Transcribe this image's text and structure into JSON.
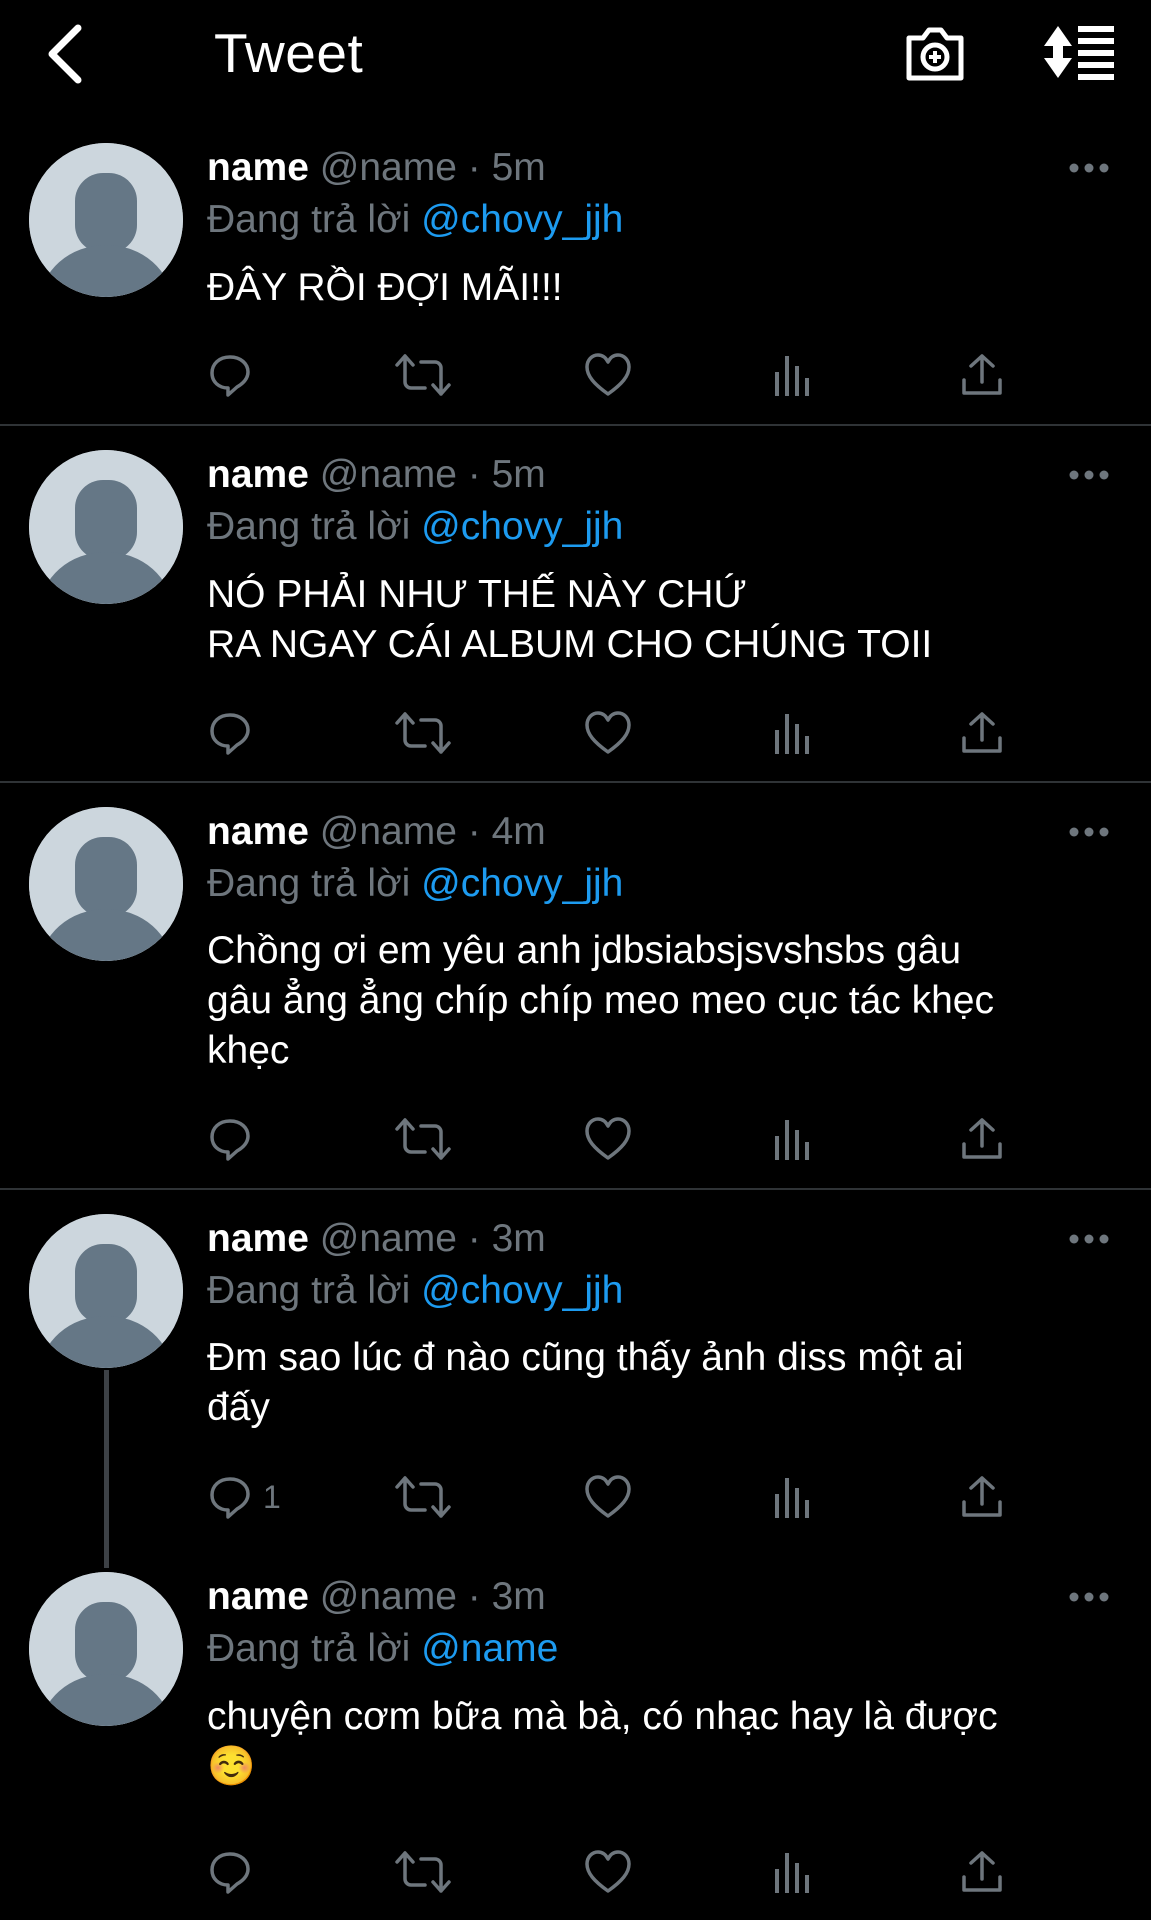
{
  "header": {
    "title": "Tweet",
    "back_icon": "chevron-left-icon",
    "camera_icon": "camera-plus-icon",
    "sort_icon": "sort-icon"
  },
  "colors": {
    "background": "#000000",
    "mention": "#1d9bf0",
    "muted": "#6e767d",
    "avatar": "#ccd6dd"
  },
  "tweets": [
    {
      "name": "name",
      "handle": "@name",
      "dot": "·",
      "time": "5m",
      "replying": "Đang trả lời",
      "reply_to": "@chovy_jjh",
      "text": [
        "ĐÂY RỒI ĐỢI MÃI!!!"
      ],
      "reply_count": ""
    },
    {
      "name": "name",
      "handle": "@name",
      "dot": "·",
      "time": "5m",
      "replying": "Đang trả lời",
      "reply_to": "@chovy_jjh",
      "text": [
        "NÓ PHẢI NHƯ THẾ NÀY CHỨ",
        "RA NGAY CÁI ALBUM CHO CHÚNG TOII"
      ],
      "reply_count": ""
    },
    {
      "name": "name",
      "handle": "@name",
      "dot": "·",
      "time": "4m",
      "replying": "Đang trả lời",
      "reply_to": "@chovy_jjh",
      "text": [
        "Chồng ơi em yêu anh jdbsiabsjsvshsbs gâu",
        "gâu ẳng ẳng chíp chíp meo meo cục tác khẹc",
        "khẹc"
      ],
      "reply_count": ""
    },
    {
      "name": "name",
      "handle": "@name",
      "dot": "·",
      "time": "3m",
      "replying": "Đang trả lời",
      "reply_to": "@chovy_jjh",
      "text": [
        "Đm sao lúc đ nào cũng thấy ảnh diss một ai",
        "đấy"
      ],
      "reply_count": "1"
    },
    {
      "name": "name",
      "handle": "@name",
      "dot": "·",
      "time": "3m",
      "replying": "Đang trả lời",
      "reply_to": "@name",
      "text": [
        "chuyện cơm bữa mà bà, có nhạc hay là được",
        "☺️"
      ],
      "reply_count": ""
    }
  ]
}
